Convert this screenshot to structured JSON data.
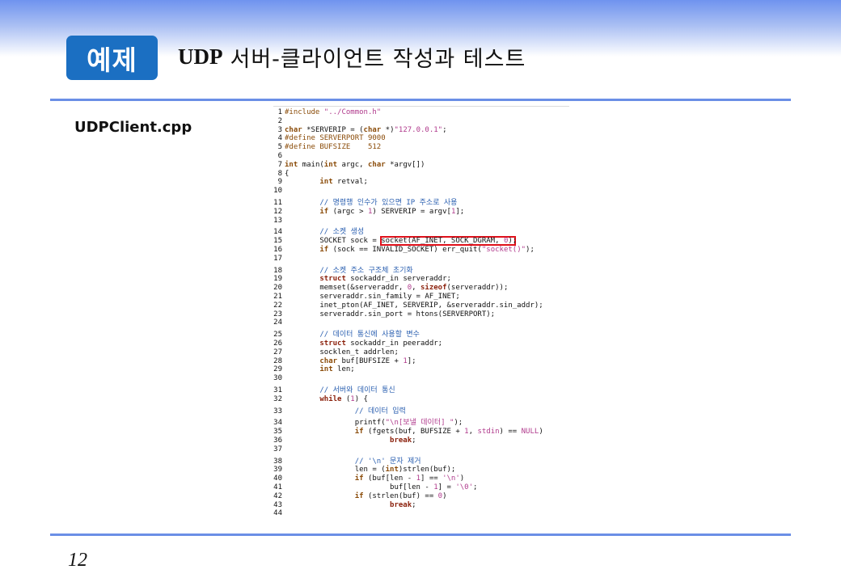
{
  "slide": {
    "badge": "예제",
    "title_prefix": "UDP",
    "title_rest": "서버-클라이언트 작성과 테스트",
    "filename": "UDPClient.cpp",
    "page_number": "12"
  },
  "colors": {
    "badge_bg": "#1b6fc2",
    "rule": "#6b8fe6",
    "highlight": "#e0101a",
    "keyword": "#8a4b08",
    "string": "#b03a8c",
    "comment": "#2a5fb0"
  },
  "code": {
    "highlighted_call": "socket(AF_INET, SOCK_DGRAM, 0)",
    "lines": [
      {
        "n": "1",
        "parts": [
          {
            "t": "pp",
            "s": "#include "
          },
          {
            "t": "str",
            "s": "\"../Common.h\""
          }
        ]
      },
      {
        "n": "2",
        "parts": []
      },
      {
        "n": "3",
        "parts": [
          {
            "t": "kw",
            "s": "char"
          },
          {
            "t": "",
            "s": " *SERVERIP = ("
          },
          {
            "t": "kw",
            "s": "char"
          },
          {
            "t": "",
            "s": " *)"
          },
          {
            "t": "str",
            "s": "\"127.0.0.1\""
          },
          {
            "t": "",
            "s": ";"
          }
        ]
      },
      {
        "n": "4",
        "parts": [
          {
            "t": "pp",
            "s": "#define SERVERPORT 9000"
          }
        ]
      },
      {
        "n": "5",
        "parts": [
          {
            "t": "pp",
            "s": "#define BUFSIZE    512"
          }
        ]
      },
      {
        "n": "6",
        "parts": []
      },
      {
        "n": "7",
        "parts": [
          {
            "t": "kw",
            "s": "int"
          },
          {
            "t": "",
            "s": " main("
          },
          {
            "t": "kw",
            "s": "int"
          },
          {
            "t": "",
            "s": " argc, "
          },
          {
            "t": "kw",
            "s": "char"
          },
          {
            "t": "",
            "s": " *argv[])"
          }
        ]
      },
      {
        "n": "8",
        "parts": [
          {
            "t": "",
            "s": "{"
          }
        ]
      },
      {
        "n": "9",
        "parts": [
          {
            "t": "",
            "s": "        "
          },
          {
            "t": "kw",
            "s": "int"
          },
          {
            "t": "",
            "s": " retval;"
          }
        ]
      },
      {
        "n": "10",
        "parts": []
      },
      {
        "n": "11",
        "parts": [
          {
            "t": "",
            "s": "        "
          },
          {
            "t": "cm",
            "s": "// 명령행 인수가 있으면 IP 주소로 사용"
          }
        ]
      },
      {
        "n": "12",
        "parts": [
          {
            "t": "",
            "s": "        "
          },
          {
            "t": "kw",
            "s": "if"
          },
          {
            "t": "",
            "s": " (argc > "
          },
          {
            "t": "num",
            "s": "1"
          },
          {
            "t": "",
            "s": ") SERVERIP = argv["
          },
          {
            "t": "num",
            "s": "1"
          },
          {
            "t": "",
            "s": "];"
          }
        ]
      },
      {
        "n": "13",
        "parts": []
      },
      {
        "n": "14",
        "parts": [
          {
            "t": "",
            "s": "        "
          },
          {
            "t": "cm",
            "s": "// 소켓 생성"
          }
        ]
      },
      {
        "n": "15",
        "parts": [
          {
            "t": "",
            "s": "        SOCKET sock = socket(AF_INET, SOCK_DGRAM, "
          },
          {
            "t": "num",
            "s": "0"
          },
          {
            "t": "",
            "s": ");"
          }
        ]
      },
      {
        "n": "16",
        "parts": [
          {
            "t": "",
            "s": "        "
          },
          {
            "t": "kw",
            "s": "if"
          },
          {
            "t": "",
            "s": " (sock == INVALID_SOCKET) err_quit("
          },
          {
            "t": "str",
            "s": "\"socket()\""
          },
          {
            "t": "",
            "s": ");"
          }
        ]
      },
      {
        "n": "17",
        "parts": []
      },
      {
        "n": "18",
        "parts": [
          {
            "t": "",
            "s": "        "
          },
          {
            "t": "cm",
            "s": "// 소켓 주소 구조체 초기화"
          }
        ]
      },
      {
        "n": "19",
        "parts": [
          {
            "t": "",
            "s": "        "
          },
          {
            "t": "kw2",
            "s": "struct"
          },
          {
            "t": "",
            "s": " sockaddr_in serveraddr;"
          }
        ]
      },
      {
        "n": "20",
        "parts": [
          {
            "t": "",
            "s": "        memset(&serveraddr, "
          },
          {
            "t": "num",
            "s": "0"
          },
          {
            "t": "",
            "s": ", "
          },
          {
            "t": "kw2",
            "s": "sizeof"
          },
          {
            "t": "",
            "s": "(serveraddr));"
          }
        ]
      },
      {
        "n": "21",
        "parts": [
          {
            "t": "",
            "s": "        serveraddr.sin_family = AF_INET;"
          }
        ]
      },
      {
        "n": "22",
        "parts": [
          {
            "t": "",
            "s": "        inet_pton(AF_INET, SERVERIP, &serveraddr.sin_addr);"
          }
        ]
      },
      {
        "n": "23",
        "parts": [
          {
            "t": "",
            "s": "        serveraddr.sin_port = htons(SERVERPORT);"
          }
        ]
      },
      {
        "n": "24",
        "parts": []
      },
      {
        "n": "25",
        "parts": [
          {
            "t": "",
            "s": "        "
          },
          {
            "t": "cm",
            "s": "// 데이터 통신에 사용할 변수"
          }
        ]
      },
      {
        "n": "26",
        "parts": [
          {
            "t": "",
            "s": "        "
          },
          {
            "t": "kw2",
            "s": "struct"
          },
          {
            "t": "",
            "s": " sockaddr_in peeraddr;"
          }
        ]
      },
      {
        "n": "27",
        "parts": [
          {
            "t": "",
            "s": "        socklen_t addrlen;"
          }
        ]
      },
      {
        "n": "28",
        "parts": [
          {
            "t": "",
            "s": "        "
          },
          {
            "t": "kw",
            "s": "char"
          },
          {
            "t": "",
            "s": " buf[BUFSIZE + "
          },
          {
            "t": "num",
            "s": "1"
          },
          {
            "t": "",
            "s": "];"
          }
        ]
      },
      {
        "n": "29",
        "parts": [
          {
            "t": "",
            "s": "        "
          },
          {
            "t": "kw",
            "s": "int"
          },
          {
            "t": "",
            "s": " len;"
          }
        ]
      },
      {
        "n": "30",
        "parts": []
      },
      {
        "n": "31",
        "parts": [
          {
            "t": "",
            "s": "        "
          },
          {
            "t": "cm",
            "s": "// 서버와 데이터 통신"
          }
        ]
      },
      {
        "n": "32",
        "parts": [
          {
            "t": "",
            "s": "        "
          },
          {
            "t": "kw2",
            "s": "while"
          },
          {
            "t": "",
            "s": " ("
          },
          {
            "t": "num",
            "s": "1"
          },
          {
            "t": "",
            "s": ") {"
          }
        ]
      },
      {
        "n": "33",
        "parts": [
          {
            "t": "",
            "s": "                "
          },
          {
            "t": "cm",
            "s": "// 데이터 입력"
          }
        ]
      },
      {
        "n": "34",
        "parts": [
          {
            "t": "",
            "s": "                printf("
          },
          {
            "t": "str",
            "s": "\"\\n[보낼 데이터] \""
          },
          {
            "t": "",
            "s": ");"
          }
        ]
      },
      {
        "n": "35",
        "parts": [
          {
            "t": "",
            "s": "                "
          },
          {
            "t": "kw",
            "s": "if"
          },
          {
            "t": "",
            "s": " (fgets(buf, BUFSIZE + "
          },
          {
            "t": "num",
            "s": "1"
          },
          {
            "t": "",
            "s": ", "
          },
          {
            "t": "str",
            "s": "stdin"
          },
          {
            "t": "",
            "s": ") == "
          },
          {
            "t": "str",
            "s": "NULL"
          },
          {
            "t": "",
            "s": ")"
          }
        ]
      },
      {
        "n": "36",
        "parts": [
          {
            "t": "",
            "s": "                        "
          },
          {
            "t": "kw2",
            "s": "break"
          },
          {
            "t": "",
            "s": ";"
          }
        ]
      },
      {
        "n": "37",
        "parts": []
      },
      {
        "n": "38",
        "parts": [
          {
            "t": "",
            "s": "                "
          },
          {
            "t": "cm",
            "s": "// '\\n' 문자 제거"
          }
        ]
      },
      {
        "n": "39",
        "parts": [
          {
            "t": "",
            "s": "                len = ("
          },
          {
            "t": "kw",
            "s": "int"
          },
          {
            "t": "",
            "s": ")strlen(buf);"
          }
        ]
      },
      {
        "n": "40",
        "parts": [
          {
            "t": "",
            "s": "                "
          },
          {
            "t": "kw",
            "s": "if"
          },
          {
            "t": "",
            "s": " (buf[len - "
          },
          {
            "t": "num",
            "s": "1"
          },
          {
            "t": "",
            "s": "] == "
          },
          {
            "t": "str",
            "s": "'\\n'"
          },
          {
            "t": "",
            "s": ")"
          }
        ]
      },
      {
        "n": "41",
        "parts": [
          {
            "t": "",
            "s": "                        buf[len - "
          },
          {
            "t": "num",
            "s": "1"
          },
          {
            "t": "",
            "s": "] = "
          },
          {
            "t": "str",
            "s": "'\\0'"
          },
          {
            "t": "",
            "s": ";"
          }
        ]
      },
      {
        "n": "42",
        "parts": [
          {
            "t": "",
            "s": "                "
          },
          {
            "t": "kw",
            "s": "if"
          },
          {
            "t": "",
            "s": " (strlen(buf) == "
          },
          {
            "t": "num",
            "s": "0"
          },
          {
            "t": "",
            "s": ")"
          }
        ]
      },
      {
        "n": "43",
        "parts": [
          {
            "t": "",
            "s": "                        "
          },
          {
            "t": "kw2",
            "s": "break"
          },
          {
            "t": "",
            "s": ";"
          }
        ]
      },
      {
        "n": "44",
        "parts": []
      }
    ]
  }
}
